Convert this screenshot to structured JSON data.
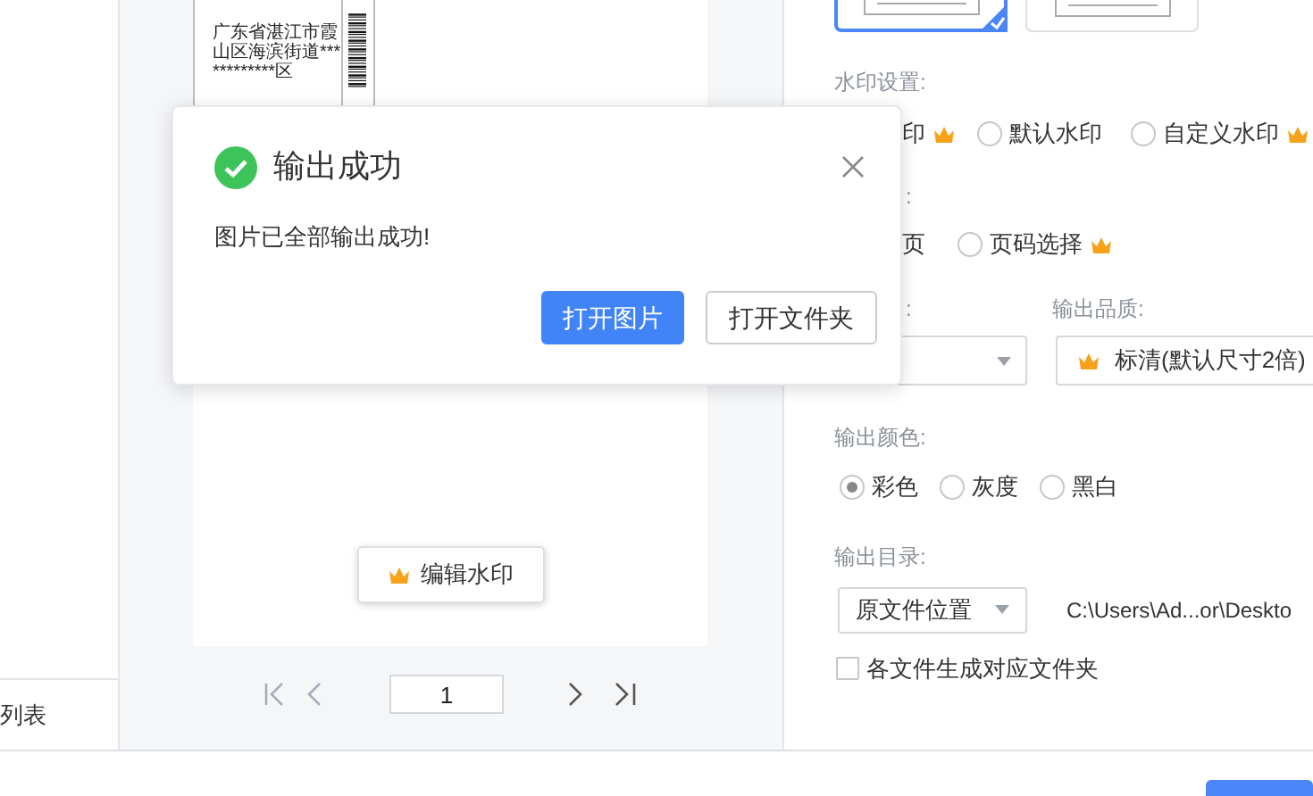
{
  "sidebar": {
    "bottom_label": "列表"
  },
  "preview": {
    "label_lines": [
      "广东省湛江市霞",
      "山区海滨街道***",
      "*********区"
    ],
    "edit_button": "编辑水印",
    "page_input": "1"
  },
  "settings": {
    "layouts": [
      {
        "selected": true
      },
      {
        "selected": false
      }
    ],
    "watermark": {
      "label": "水印设置:",
      "cut_label": "印",
      "options": [
        {
          "label": "默认水印",
          "selected": false,
          "premium": false
        },
        {
          "label": "自定义水印",
          "selected": false,
          "premium": true
        }
      ]
    },
    "pages": {
      "label": ":",
      "cut_label": "页",
      "options": [
        {
          "label": "页码选择",
          "selected": false,
          "premium": true
        }
      ]
    },
    "format_label": ":",
    "quality": {
      "label": "输出品质:",
      "value": "标清(默认尺寸2倍)"
    },
    "color": {
      "label": "输出颜色:",
      "options": [
        {
          "label": "彩色",
          "selected": true
        },
        {
          "label": "灰度",
          "selected": false
        },
        {
          "label": "黑白",
          "selected": false
        }
      ]
    },
    "directory": {
      "label": "输出目录:",
      "value": "原文件位置",
      "path": "C:\\Users\\Ad...or\\Deskto"
    },
    "subfolder": {
      "label": "各文件生成对应文件夹",
      "checked": false
    }
  },
  "dialog": {
    "title": "输出成功",
    "message": "图片已全部输出成功!",
    "buttons": [
      {
        "label": "打开图片",
        "kind": "primary"
      },
      {
        "label": "打开文件夹",
        "kind": "default"
      }
    ]
  }
}
